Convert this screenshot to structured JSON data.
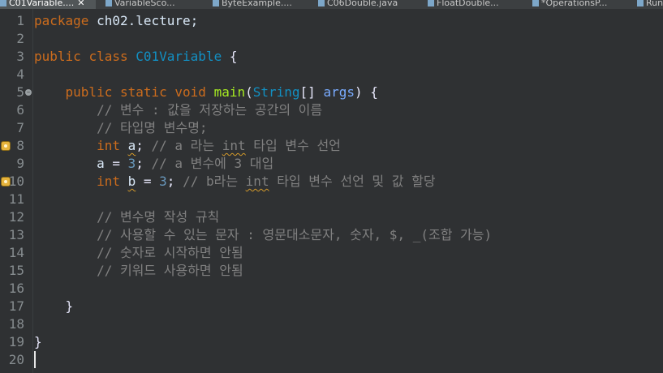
{
  "editor_tabs": [
    {
      "label": "C01Variable....",
      "active": true,
      "close": "✕"
    },
    {
      "label": "VariableSco..."
    },
    {
      "label": "ByteExample...."
    },
    {
      "label": "C06Double.java"
    },
    {
      "label": "FloatDouble..."
    },
    {
      "label": "*OperationsP..."
    },
    {
      "label": "Run"
    }
  ],
  "gutter": {
    "line_numbers": [
      "1",
      "2",
      "3",
      "4",
      "5",
      "6",
      "7",
      "8",
      "9",
      "10",
      "11",
      "12",
      "13",
      "14",
      "15",
      "16",
      "17",
      "18",
      "19",
      "20"
    ],
    "fold_marker_line": 5,
    "warning_lines": [
      8,
      10
    ]
  },
  "code": {
    "l1": {
      "t1": "package",
      "t2": " ch02.lecture;"
    },
    "l3": {
      "t1": "public",
      "t2": " ",
      "t3": "class",
      "t4": " C01Variable",
      "t5": " {"
    },
    "l5": {
      "t0": "    ",
      "t1": "public",
      "t2": " ",
      "t3": "static",
      "t4": " ",
      "t5": "void",
      "t6": " ",
      "t7": "main",
      "t8": "(",
      "t9": "String",
      "t10": "[] ",
      "t11": "args",
      "t12": ") {"
    },
    "l6": {
      "t0": "        ",
      "t1": "// 변수 : 값을 저장하는 공간의 이름"
    },
    "l7": {
      "t0": "        ",
      "t1": "// 타입명 변수명;"
    },
    "l8": {
      "t0": "        ",
      "t1": "int",
      "t2": " ",
      "t3": "a",
      "t4": "; ",
      "t5": "// a 라는 ",
      "t6": "int",
      "t7": " 타입 변수 선언"
    },
    "l9": {
      "t0": "        ",
      "t1": "a",
      "t2": " = ",
      "t3": "3",
      "t4": "; ",
      "t5": "// a 변수에 3 대입"
    },
    "l10": {
      "t0": "        ",
      "t1": "int",
      "t2": " ",
      "t3": "b",
      "t4": " = ",
      "t5": "3",
      "t6": "; ",
      "t7": "// b라는 ",
      "t8": "int",
      "t9": " 타입 변수 선언 및 값 할당"
    },
    "l12": {
      "t0": "        ",
      "t1": "// 변수명 작성 규칙"
    },
    "l13": {
      "t0": "        ",
      "t1": "// 사용할 수 있는 문자 : 영문대소문자, 숫자, $, _(조합 가능)"
    },
    "l14": {
      "t0": "        ",
      "t1": "// 숫자로 시작하면 안됨"
    },
    "l15": {
      "t0": "        ",
      "t1": "// 키워드 사용하면 안됨"
    },
    "l17": {
      "t0": "    ",
      "t1": "}"
    },
    "l19": {
      "t1": "}"
    }
  },
  "colors": {
    "background": "#2f3133",
    "keyword": "#cc6c1d",
    "type": "#1290c3",
    "method": "#a7ec21",
    "parameter": "#79abff",
    "number": "#6897bb",
    "comment": "#808080",
    "identifier": "#d9e8f7",
    "warning": "#e6b33c"
  }
}
